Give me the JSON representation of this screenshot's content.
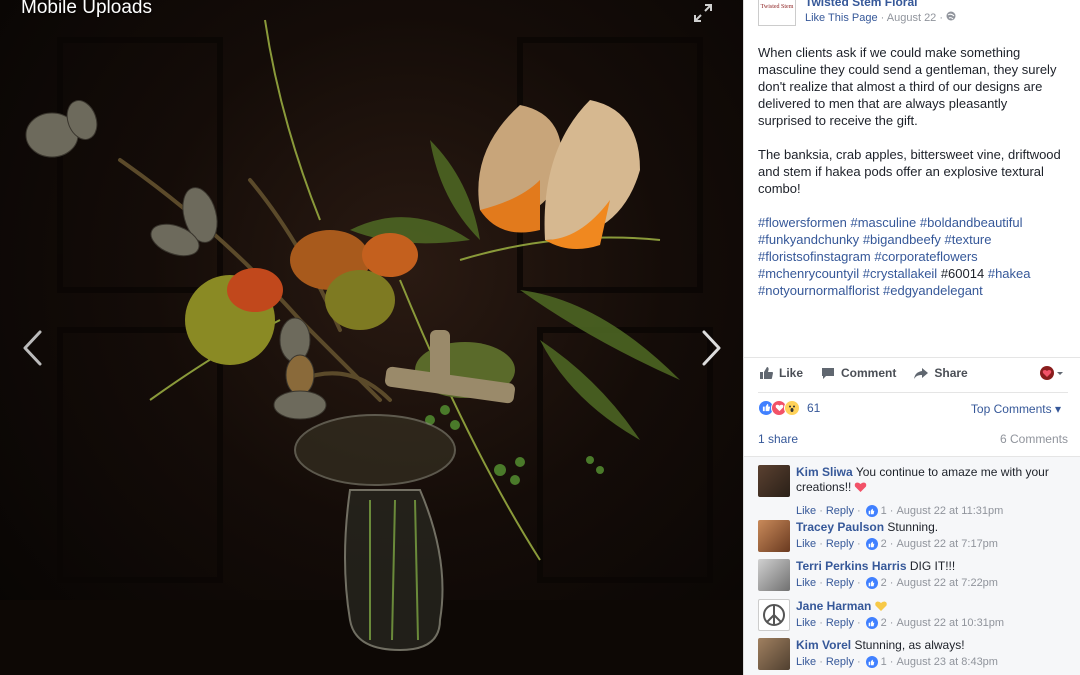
{
  "photo": {
    "album_title": "Mobile Uploads",
    "icons": {
      "expand": "expand-icon",
      "prev": "chevron-left-icon",
      "next": "chevron-right-icon"
    }
  },
  "post": {
    "page_name": "Twisted Stem Floral",
    "logo_text": "Twisted Stem",
    "like_page": "Like This Page",
    "date": "August 22",
    "paragraph1": "When clients ask if we could make something masculine they could send a gentleman, they surely don't realize that almost a third of our designs are delivered to men that are always pleasantly surprised to receive the gift.",
    "paragraph2": "The banksia, crab apples, bittersweet vine, driftwood and stem if hakea pods offer an explosive textural combo!",
    "hashtags": [
      "#flowersformen",
      "#masculine",
      "#boldandbeautiful",
      "#funkyandchunky",
      "#bigandbeefy",
      "#texture",
      "#floristsofinstagram",
      "#corporateflowers",
      "#mchenrycountyil",
      "#crystallakeil",
      "#60014",
      "#hakea",
      "#notyournormalflorist",
      "#edgyandelegant"
    ],
    "plain_tag": "#60014"
  },
  "actions": {
    "like": "Like",
    "comment": "Comment",
    "share": "Share"
  },
  "reactions": {
    "count": "61",
    "top_comments": "Top Comments",
    "shares": "1 share",
    "comments_count": "6 Comments"
  },
  "comments": [
    {
      "name": "Kim Sliwa",
      "text": "You continue to amaze me with your creations!!",
      "emoji": "heart",
      "likes": "1",
      "time": "August 22 at 11:31pm"
    },
    {
      "name": "Tracey Paulson",
      "text": "Stunning.",
      "emoji": "",
      "likes": "2",
      "time": "August 22 at 7:17pm"
    },
    {
      "name": "Terri Perkins Harris",
      "text": "DIG IT!!!",
      "emoji": "",
      "likes": "2",
      "time": "August 22 at 7:22pm"
    },
    {
      "name": "Jane Harman",
      "text": "",
      "emoji": "yellow-heart",
      "likes": "2",
      "time": "August 22 at 10:31pm"
    },
    {
      "name": "Kim Vorel",
      "text": "Stunning, as always!",
      "emoji": "",
      "likes": "1",
      "time": "August 23 at 8:43pm"
    }
  ],
  "comment_actions": {
    "like": "Like",
    "reply": "Reply"
  },
  "colors": {
    "link": "#365899",
    "text": "#1d2129",
    "meta": "#90949c",
    "like_blue": "#4080ff",
    "love_red": "#f25268"
  }
}
